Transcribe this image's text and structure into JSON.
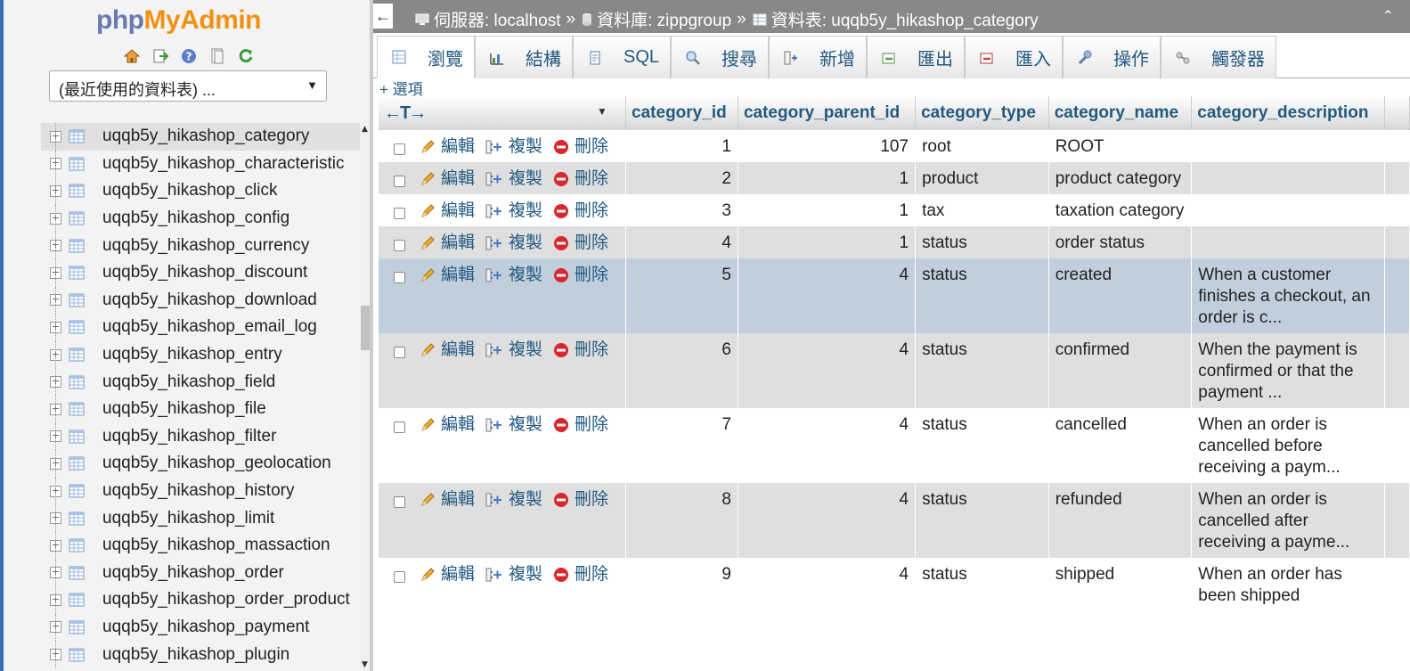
{
  "logo": {
    "php": "php",
    "my": "My",
    "admin": "Admin"
  },
  "nav_icons": [
    "home-icon",
    "exit-icon",
    "help-icon",
    "docs-icon",
    "reload-icon"
  ],
  "recent": {
    "selected": "(最近使用的資料表) ..."
  },
  "tree": {
    "selected_index": 0,
    "items": [
      "uqqb5y_hikashop_category",
      "uqqb5y_hikashop_characteristic",
      "uqqb5y_hikashop_click",
      "uqqb5y_hikashop_config",
      "uqqb5y_hikashop_currency",
      "uqqb5y_hikashop_discount",
      "uqqb5y_hikashop_download",
      "uqqb5y_hikashop_email_log",
      "uqqb5y_hikashop_entry",
      "uqqb5y_hikashop_field",
      "uqqb5y_hikashop_file",
      "uqqb5y_hikashop_filter",
      "uqqb5y_hikashop_geolocation",
      "uqqb5y_hikashop_history",
      "uqqb5y_hikashop_limit",
      "uqqb5y_hikashop_massaction",
      "uqqb5y_hikashop_order",
      "uqqb5y_hikashop_order_product",
      "uqqb5y_hikashop_payment",
      "uqqb5y_hikashop_plugin"
    ]
  },
  "breadcrumb": {
    "back": "←",
    "server": "伺服器: localhost",
    "sep": "»",
    "database": "資料庫: zippgroup",
    "table": "資料表: uqqb5y_hikashop_category",
    "collapse": "⌃"
  },
  "tabs": [
    {
      "label": "瀏覽",
      "icon": "browse-icon"
    },
    {
      "label": "結構",
      "icon": "structure-icon"
    },
    {
      "label": "SQL",
      "icon": "sql-icon"
    },
    {
      "label": "搜尋",
      "icon": "search-icon"
    },
    {
      "label": "新增",
      "icon": "insert-icon"
    },
    {
      "label": "匯出",
      "icon": "export-icon"
    },
    {
      "label": "匯入",
      "icon": "import-icon"
    },
    {
      "label": "操作",
      "icon": "operations-icon"
    },
    {
      "label": "觸發器",
      "icon": "triggers-icon"
    }
  ],
  "options": "+ 選項",
  "grid": {
    "arrows": "←T→",
    "columns": [
      "category_id",
      "category_parent_id",
      "category_type",
      "category_name",
      "category_description"
    ],
    "actions": {
      "edit": "編輯",
      "copy": "複製",
      "delete": "刪除"
    },
    "highlight_row": 4,
    "rows": [
      {
        "id": "1",
        "parent": "107",
        "type": "root",
        "name": "ROOT",
        "desc": ""
      },
      {
        "id": "2",
        "parent": "1",
        "type": "product",
        "name": "product category",
        "desc": ""
      },
      {
        "id": "3",
        "parent": "1",
        "type": "tax",
        "name": "taxation category",
        "desc": ""
      },
      {
        "id": "4",
        "parent": "1",
        "type": "status",
        "name": "order status",
        "desc": ""
      },
      {
        "id": "5",
        "parent": "4",
        "type": "status",
        "name": "created",
        "desc": "When a customer finishes a checkout, an order is c..."
      },
      {
        "id": "6",
        "parent": "4",
        "type": "status",
        "name": "confirmed",
        "desc": "When the payment is confirmed or that the payment ..."
      },
      {
        "id": "7",
        "parent": "4",
        "type": "status",
        "name": "cancelled",
        "desc": "When an order is cancelled before receiving a paym..."
      },
      {
        "id": "8",
        "parent": "4",
        "type": "status",
        "name": "refunded",
        "desc": "When an order is cancelled after receiving a payme..."
      },
      {
        "id": "9",
        "parent": "4",
        "type": "status",
        "name": "shipped",
        "desc": "When an order has been shipped"
      }
    ]
  }
}
